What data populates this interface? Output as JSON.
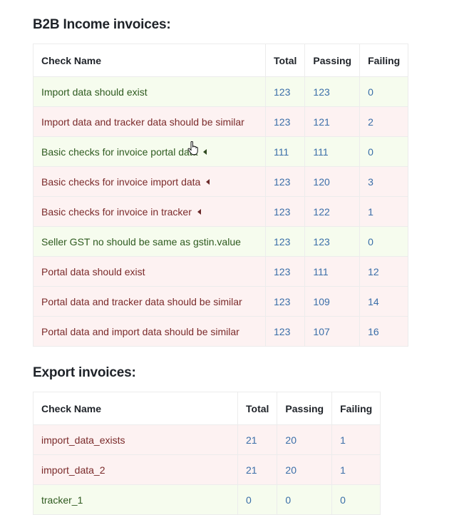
{
  "b2b": {
    "title": "B2B Income invoices:",
    "headers": [
      "Check Name",
      "Total",
      "Passing",
      "Failing"
    ],
    "rows": [
      {
        "name": "Import data should exist",
        "total": "123",
        "passing": "123",
        "failing": "0",
        "status": "pass",
        "expander": false
      },
      {
        "name": "Import data and tracker data should be similar",
        "total": "123",
        "passing": "121",
        "failing": "2",
        "status": "fail",
        "expander": false
      },
      {
        "name": "Basic checks for invoice portal data",
        "total": "111",
        "passing": "111",
        "failing": "0",
        "status": "pass",
        "expander": true
      },
      {
        "name": "Basic checks for invoice import data",
        "total": "123",
        "passing": "120",
        "failing": "3",
        "status": "fail",
        "expander": true
      },
      {
        "name": "Basic checks for invoice in tracker",
        "total": "123",
        "passing": "122",
        "failing": "1",
        "status": "fail",
        "expander": true
      },
      {
        "name": "Seller GST no should be same as gstin.value",
        "total": "123",
        "passing": "123",
        "failing": "0",
        "status": "pass",
        "expander": false
      },
      {
        "name": "Portal data should exist",
        "total": "123",
        "passing": "111",
        "failing": "12",
        "status": "fail",
        "expander": false
      },
      {
        "name": "Portal data and tracker data should be similar",
        "total": "123",
        "passing": "109",
        "failing": "14",
        "status": "fail",
        "expander": false
      },
      {
        "name": "Portal data and import data should be similar",
        "total": "123",
        "passing": "107",
        "failing": "16",
        "status": "fail",
        "expander": false
      }
    ]
  },
  "export": {
    "title": "Export invoices:",
    "headers": [
      "Check Name",
      "Total",
      "Passing",
      "Failing"
    ],
    "rows": [
      {
        "name": "import_data_exists",
        "total": "21",
        "passing": "20",
        "failing": "1",
        "status": "fail",
        "expander": false
      },
      {
        "name": "import_data_2",
        "total": "21",
        "passing": "20",
        "failing": "1",
        "status": "fail",
        "expander": false
      },
      {
        "name": "tracker_1",
        "total": "0",
        "passing": "0",
        "failing": "0",
        "status": "pass",
        "expander": false
      }
    ]
  },
  "colors": {
    "pass_row": "#f6fcee",
    "fail_row": "#fdf2f2",
    "number_link": "#3a6ea8"
  },
  "icons": {
    "expander": "caret-left-icon",
    "cursor": "hand-pointer-icon"
  }
}
